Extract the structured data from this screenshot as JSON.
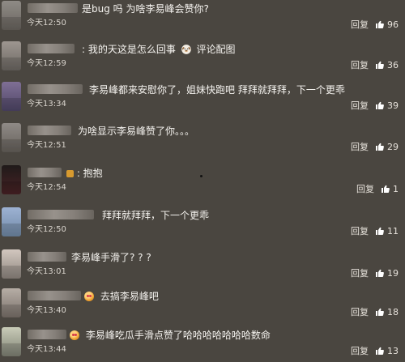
{
  "comments": [
    {
      "text": "是bug 吗 为啥李易峰会赞你?",
      "time": "今天12:50",
      "reply_label": "回复",
      "like_count": "96"
    },
    {
      "text": ": 我的天这是怎么回事",
      "attachment_label": "评论配图",
      "time": "今天12:59",
      "reply_label": "回复",
      "like_count": "36"
    },
    {
      "text": "李易峰都来安慰你了，姐妹快跑吧 拜拜就拜拜，下一个更乖",
      "time": "今天13:34",
      "reply_label": "回复",
      "like_count": "39"
    },
    {
      "text": "为啥显示李易峰赞了你。。。",
      "time": "今天12:51",
      "reply_label": "回复",
      "like_count": "29"
    },
    {
      "text": ": 抱抱",
      "time": "今天12:54",
      "reply_label": "回复",
      "like_count": "1"
    },
    {
      "text": "拜拜就拜拜，下一个更乖",
      "time": "今天12:50",
      "reply_label": "回复",
      "like_count": "11"
    },
    {
      "text": "李易峰手滑了? ? ?",
      "time": "今天13:01",
      "reply_label": "回复",
      "like_count": "19"
    },
    {
      "text": "去搞李易峰吧",
      "time": "今天13:40",
      "reply_label": "回复",
      "like_count": "18"
    },
    {
      "text": "李易峰吃瓜手滑点赞了哈哈哈哈哈哈哈数命",
      "time": "今天13:44",
      "reply_label": "回复",
      "like_count": "13"
    }
  ],
  "colors": {
    "background": "#4a4640",
    "text": "#f5f3ef",
    "muted_text": "#d9d4cd",
    "badge": "#d79a2f",
    "emoji": "#f0a433"
  },
  "icons": {
    "like": "thumbs-up-icon",
    "reply": "reply-text",
    "emoji": "face-emoji-icon",
    "attachment": "dog-sticker-icon"
  }
}
